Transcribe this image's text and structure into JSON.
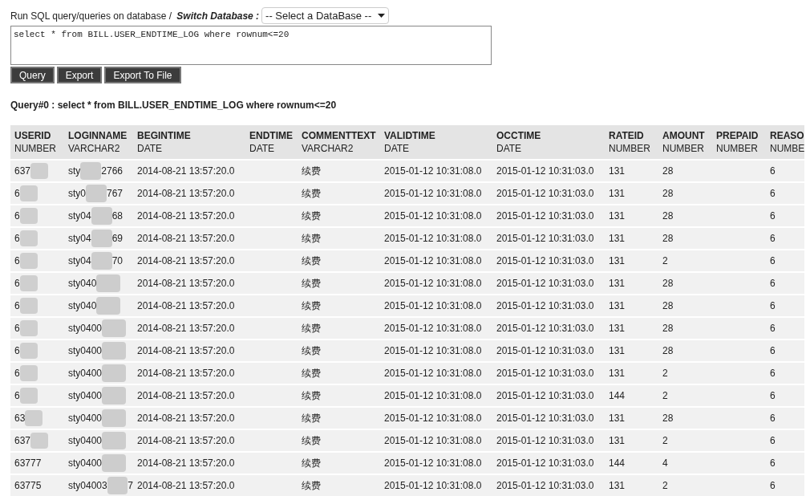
{
  "header": {
    "label": "Run SQL query/queries on database / ",
    "switch_label": "Switch Database :",
    "database_select": "-- Select a DataBase --"
  },
  "query_input": {
    "value": "select * from BILL.USER_ENDTIME_LOG where rownum<=20"
  },
  "buttons": [
    "Query",
    "Export",
    "Export To File"
  ],
  "result_title": "Query#0 : select * from BILL.USER_ENDTIME_LOG where rownum<=20",
  "table": {
    "columns": [
      {
        "name": "USERID",
        "type": "NUMBER"
      },
      {
        "name": "LOGINNAME",
        "type": "VARCHAR2"
      },
      {
        "name": "BEGINTIME",
        "type": "DATE"
      },
      {
        "name": "ENDTIME",
        "type": "DATE"
      },
      {
        "name": "COMMENTTEXT",
        "type": "VARCHAR2"
      },
      {
        "name": "VALIDTIME",
        "type": "DATE"
      },
      {
        "name": "OCCTIME",
        "type": "DATE"
      },
      {
        "name": "RATEID",
        "type": "NUMBER"
      },
      {
        "name": "AMOUNT",
        "type": "NUMBER"
      },
      {
        "name": "PREPAID",
        "type": "NUMBER"
      },
      {
        "name": "REASO",
        "type": "NUMBE"
      }
    ],
    "rows": [
      {
        "cells": [
          "637",
          {
            "start": "sty",
            "end": "2766"
          },
          "2014-08-21 13:57:20.0",
          null,
          "续费",
          "2015-01-12 10:31:08.0",
          "2015-01-12 10:31:03.0",
          "131",
          "28",
          null,
          "6"
        ]
      },
      {
        "cells": [
          "6",
          {
            "start": "sty0",
            "end": "767"
          },
          "2014-08-21 13:57:20.0",
          null,
          "续费",
          "2015-01-12 10:31:08.0",
          "2015-01-12 10:31:03.0",
          "131",
          "28",
          null,
          "6"
        ]
      },
      {
        "cells": [
          "6",
          {
            "start": "sty04",
            "end": "68"
          },
          "2014-08-21 13:57:20.0",
          null,
          "续费",
          "2015-01-12 10:31:08.0",
          "2015-01-12 10:31:03.0",
          "131",
          "28",
          null,
          "6"
        ]
      },
      {
        "cells": [
          "6",
          {
            "start": "sty04",
            "end": "69"
          },
          "2014-08-21 13:57:20.0",
          null,
          "续费",
          "2015-01-12 10:31:08.0",
          "2015-01-12 10:31:03.0",
          "131",
          "28",
          null,
          "6"
        ]
      },
      {
        "cells": [
          "6",
          {
            "start": "sty04",
            "end": "70"
          },
          "2014-08-21 13:57:20.0",
          null,
          "续费",
          "2015-01-12 10:31:08.0",
          "2015-01-12 10:31:03.0",
          "131",
          "2",
          null,
          "6"
        ]
      },
      {
        "cells": [
          "6",
          {
            "start": "sty040"
          },
          "2014-08-21 13:57:20.0",
          null,
          "续费",
          "2015-01-12 10:31:08.0",
          "2015-01-12 10:31:03.0",
          "131",
          "28",
          null,
          "6"
        ]
      },
      {
        "cells": [
          "6",
          {
            "start": "sty040"
          },
          "2014-08-21 13:57:20.0",
          null,
          "续费",
          "2015-01-12 10:31:08.0",
          "2015-01-12 10:31:03.0",
          "131",
          "28",
          null,
          "6"
        ]
      },
      {
        "cells": [
          "6",
          {
            "start": "sty0400"
          },
          "2014-08-21 13:57:20.0",
          null,
          "续费",
          "2015-01-12 10:31:08.0",
          "2015-01-12 10:31:03.0",
          "131",
          "28",
          null,
          "6"
        ]
      },
      {
        "cells": [
          "6",
          {
            "start": "sty0400"
          },
          "2014-08-21 13:57:20.0",
          null,
          "续费",
          "2015-01-12 10:31:08.0",
          "2015-01-12 10:31:03.0",
          "131",
          "28",
          null,
          "6"
        ]
      },
      {
        "cells": [
          "6",
          {
            "start": "sty0400"
          },
          "2014-08-21 13:57:20.0",
          null,
          "续费",
          "2015-01-12 10:31:08.0",
          "2015-01-12 10:31:03.0",
          "131",
          "2",
          null,
          "6"
        ]
      },
      {
        "cells": [
          "6",
          {
            "start": "sty0400"
          },
          "2014-08-21 13:57:20.0",
          null,
          "续费",
          "2015-01-12 10:31:08.0",
          "2015-01-12 10:31:03.0",
          "144",
          "2",
          null,
          "6"
        ]
      },
      {
        "cells": [
          "63",
          {
            "start": "sty0400"
          },
          "2014-08-21 13:57:20.0",
          null,
          "续费",
          "2015-01-12 10:31:08.0",
          "2015-01-12 10:31:03.0",
          "131",
          "28",
          null,
          "6"
        ]
      },
      {
        "cells": [
          "637",
          {
            "start": "sty0400"
          },
          "2014-08-21 13:57:20.0",
          null,
          "续费",
          "2015-01-12 10:31:08.0",
          "2015-01-12 10:31:03.0",
          "131",
          "2",
          null,
          "6"
        ]
      },
      {
        "cells": [
          "63777",
          {
            "start": "sty0400"
          },
          "2014-08-21 13:57:20.0",
          null,
          "续费",
          "2015-01-12 10:31:08.0",
          "2015-01-12 10:31:03.0",
          "144",
          "4",
          null,
          "6"
        ]
      },
      {
        "cells": [
          "63775",
          {
            "start": "sty04003",
            "end": "7"
          },
          "2014-08-21 13:57:20.0",
          null,
          "续费",
          "2015-01-12 10:31:08.0",
          "2015-01-12 10:31:03.0",
          "131",
          "2",
          null,
          "6"
        ]
      }
    ]
  }
}
